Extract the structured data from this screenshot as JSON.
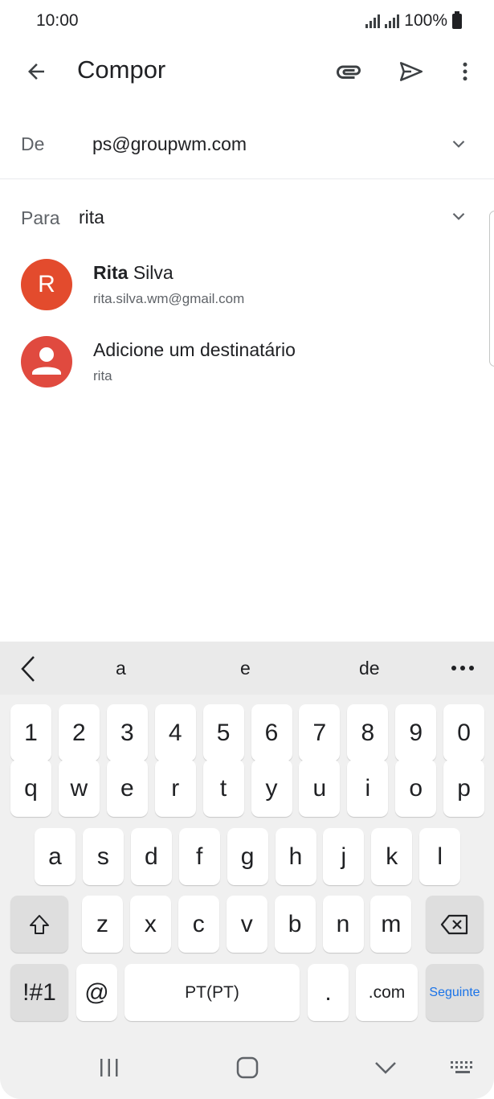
{
  "status_bar": {
    "time": "10:00",
    "battery": "100%"
  },
  "app_bar": {
    "title": "Compor"
  },
  "from": {
    "label": "De",
    "value": "ps@groupwm.com"
  },
  "to": {
    "label": "Para",
    "value": "rita"
  },
  "suggestions": [
    {
      "initial": "R",
      "name_bold": "Rita",
      "name_rest": " Silva",
      "email": "rita.silva.wm@gmail.com"
    },
    {
      "name": "Adicione um destinatário",
      "sub": "rita"
    }
  ],
  "keyboard": {
    "predictions": [
      "a",
      "e",
      "de"
    ],
    "numbers": [
      "1",
      "2",
      "3",
      "4",
      "5",
      "6",
      "7",
      "8",
      "9",
      "0"
    ],
    "row1": [
      "q",
      "w",
      "e",
      "r",
      "t",
      "y",
      "u",
      "i",
      "o",
      "p"
    ],
    "row2": [
      "a",
      "s",
      "d",
      "f",
      "g",
      "h",
      "j",
      "k",
      "l"
    ],
    "row3": [
      "z",
      "x",
      "c",
      "v",
      "b",
      "n",
      "m"
    ],
    "symbols_key": "!#1",
    "at_key": "@",
    "space_key": "PT(PT)",
    "period_key": ".",
    "com_key": ".com",
    "enter_key": "Seguinte"
  },
  "colors": {
    "avatar": "#e34b2d",
    "enter_text": "#1a73e8"
  }
}
